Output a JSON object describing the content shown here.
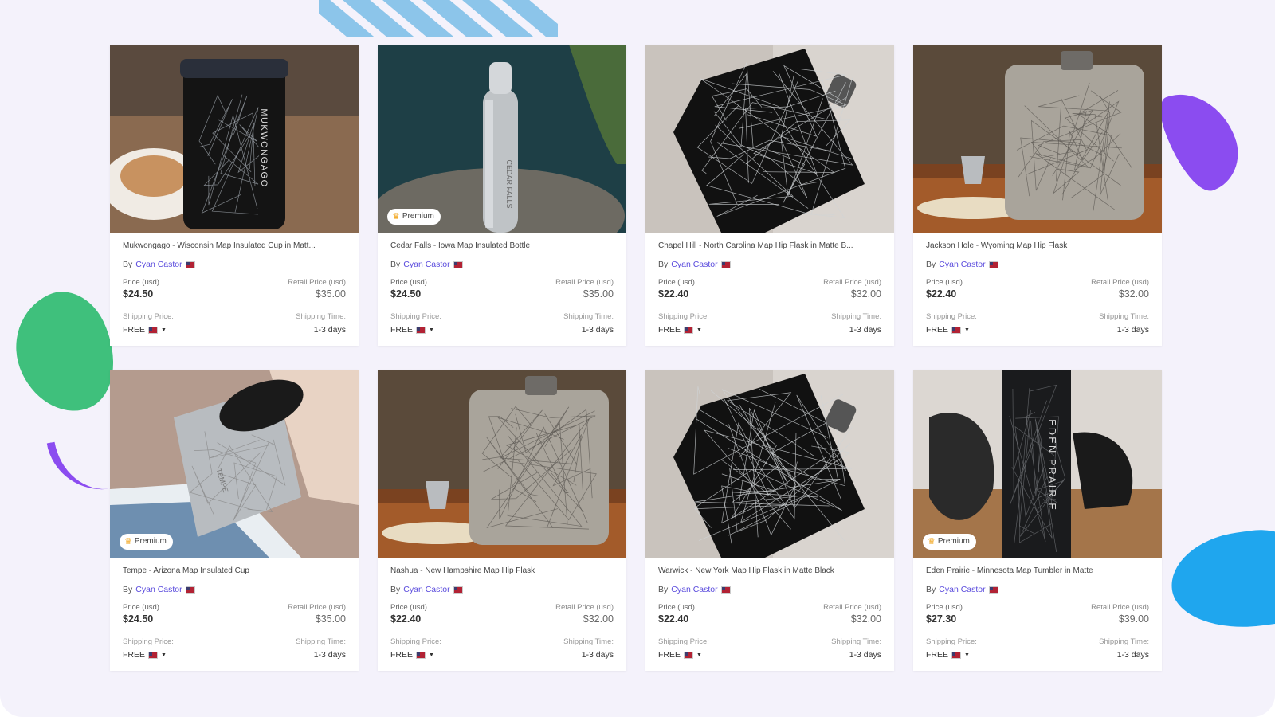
{
  "products": [
    {
      "title": "Mukwongago - Wisconsin Map Insulated Cup in Matt...",
      "by": "By",
      "seller": "Cyan Castor",
      "price_label": "Price (usd)",
      "price": "$24.50",
      "retail_label": "Retail Price (usd)",
      "retail": "$35.00",
      "shipping_label": "Shipping Price:",
      "shipping": "FREE",
      "time_label": "Shipping Time:",
      "time": "1-3 days",
      "premium": null,
      "engraving": "MUKWONGAGO",
      "image_kind": "cup-black"
    },
    {
      "title": "Cedar Falls - Iowa Map Insulated Bottle",
      "by": "By",
      "seller": "Cyan Castor",
      "price_label": "Price (usd)",
      "price": "$24.50",
      "retail_label": "Retail Price (usd)",
      "retail": "$35.00",
      "shipping_label": "Shipping Price:",
      "shipping": "FREE",
      "time_label": "Shipping Time:",
      "time": "1-3 days",
      "premium": "Premium",
      "engraving": "CEDAR FALLS",
      "image_kind": "bottle-steel"
    },
    {
      "title": "Chapel Hill - North Carolina Map Hip Flask in Matte B...",
      "by": "By",
      "seller": "Cyan Castor",
      "price_label": "Price (usd)",
      "price": "$22.40",
      "retail_label": "Retail Price (usd)",
      "retail": "$32.00",
      "shipping_label": "Shipping Price:",
      "shipping": "FREE",
      "time_label": "Shipping Time:",
      "time": "1-3 days",
      "premium": null,
      "engraving": "",
      "image_kind": "flask-black"
    },
    {
      "title": "Jackson Hole - Wyoming Map Hip Flask",
      "by": "By",
      "seller": "Cyan Castor",
      "price_label": "Price (usd)",
      "price": "$22.40",
      "retail_label": "Retail Price (usd)",
      "retail": "$32.00",
      "shipping_label": "Shipping Price:",
      "shipping": "FREE",
      "time_label": "Shipping Time:",
      "time": "1-3 days",
      "premium": null,
      "engraving": "",
      "image_kind": "flask-steel"
    },
    {
      "title": "Tempe - Arizona Map Insulated Cup",
      "by": "By",
      "seller": "Cyan Castor",
      "price_label": "Price (usd)",
      "price": "$24.50",
      "retail_label": "Retail Price (usd)",
      "retail": "$35.00",
      "shipping_label": "Shipping Price:",
      "shipping": "FREE",
      "time_label": "Shipping Time:",
      "time": "1-3 days",
      "premium": "Premium",
      "engraving": "TEMPE",
      "image_kind": "cup-steel"
    },
    {
      "title": "Nashua - New Hampshire Map Hip Flask",
      "by": "By",
      "seller": "Cyan Castor",
      "price_label": "Price (usd)",
      "price": "$22.40",
      "retail_label": "Retail Price (usd)",
      "retail": "$32.00",
      "shipping_label": "Shipping Price:",
      "shipping": "FREE",
      "time_label": "Shipping Time:",
      "time": "1-3 days",
      "premium": null,
      "engraving": "",
      "image_kind": "flask-steel"
    },
    {
      "title": "Warwick - New York Map Hip Flask in Matte Black",
      "by": "By",
      "seller": "Cyan Castor",
      "price_label": "Price (usd)",
      "price": "$22.40",
      "retail_label": "Retail Price (usd)",
      "retail": "$32.00",
      "shipping_label": "Shipping Price:",
      "shipping": "FREE",
      "time_label": "Shipping Time:",
      "time": "1-3 days",
      "premium": null,
      "engraving": "",
      "image_kind": "flask-black"
    },
    {
      "title": "Eden Prairie - Minnesota Map Tumbler in Matte",
      "by": "By",
      "seller": "Cyan Castor",
      "price_label": "Price (usd)",
      "price": "$27.30",
      "retail_label": "Retail Price (usd)",
      "retail": "$39.00",
      "shipping_label": "Shipping Price:",
      "shipping": "FREE",
      "time_label": "Shipping Time:",
      "time": "1-3 days",
      "premium": "Premium",
      "engraving": "EDEN PRAIRIE",
      "image_kind": "tumbler-black"
    }
  ],
  "colors": {
    "background": "#f4f2fb",
    "seller_link": "#5a4bdd",
    "premium_crown": "#f2a51b"
  },
  "icons": {
    "premium": "crown-icon",
    "flag": "us-flag-icon",
    "dropdown": "caret-down-icon"
  }
}
